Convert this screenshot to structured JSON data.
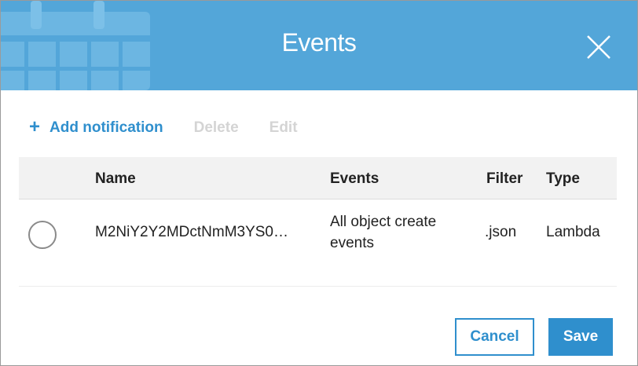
{
  "dialog": {
    "title": "Events",
    "header_icon": "calendar-icon",
    "close_icon": "close-icon"
  },
  "toolbar": {
    "add_icon": "plus-icon",
    "add_label": "Add notification",
    "delete_label": "Delete",
    "edit_label": "Edit"
  },
  "table": {
    "columns": [
      "Name",
      "Events",
      "Filter",
      "Type"
    ],
    "rows": [
      {
        "name": "M2NiY2Y2MDctNmM3YS0…",
        "events": "All object create events",
        "filter": ".json",
        "type": "Lambda",
        "selected": false
      }
    ]
  },
  "footer": {
    "cancel_label": "Cancel",
    "save_label": "Save"
  },
  "colors": {
    "header_bg": "#53a6d9",
    "accent": "#2f8fcd",
    "disabled_text": "#d4d4d4",
    "table_header_bg": "#f2f2f2"
  }
}
